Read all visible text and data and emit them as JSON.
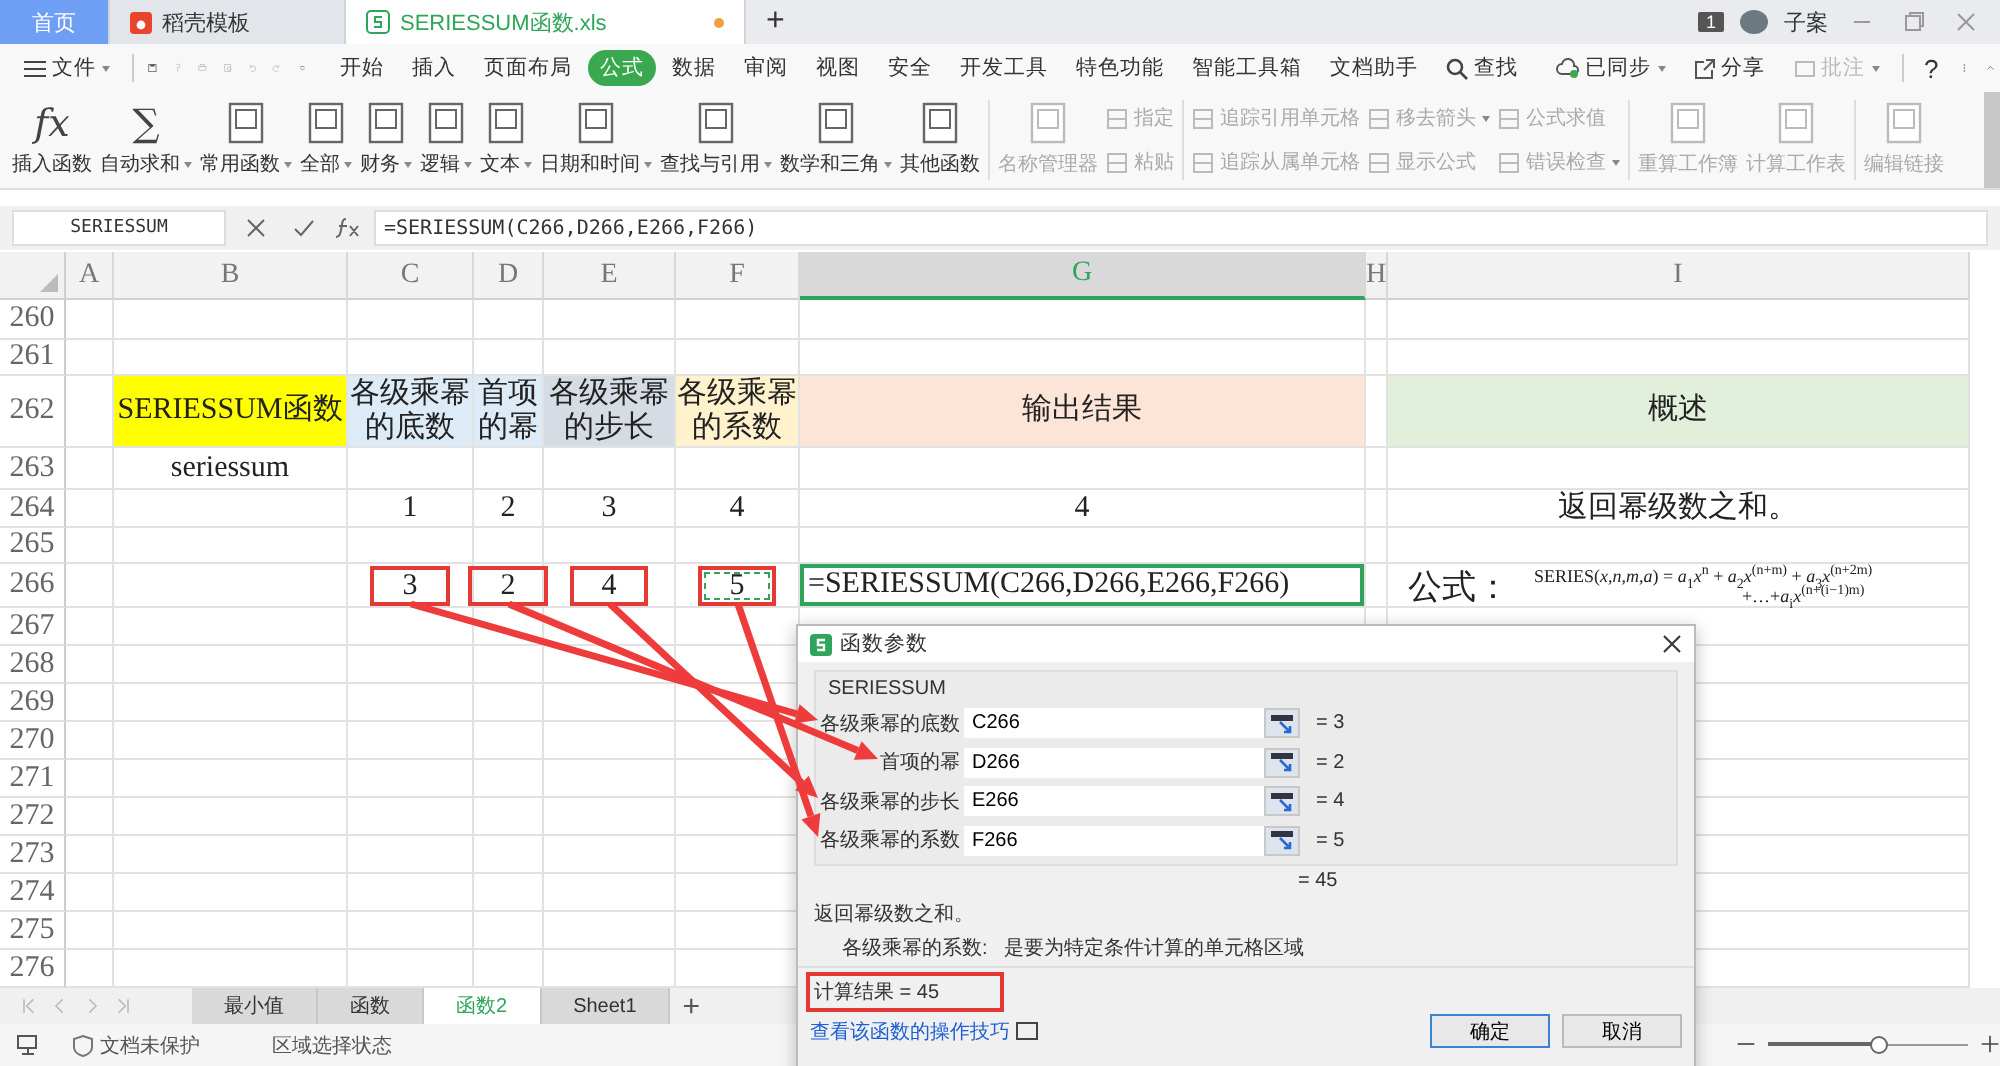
{
  "title_bar": {
    "tabs": [
      {
        "label": "首页",
        "kind": "home",
        "selected": false
      },
      {
        "label": "稻壳模板",
        "kind": "docer",
        "selected": false
      },
      {
        "label": "SERIESSUM函数.xls",
        "kind": "sheet",
        "selected": true,
        "unsaved": true
      }
    ],
    "new_tab": "+",
    "badge": "1",
    "user": "子案"
  },
  "menu": {
    "file": "文件",
    "tabs": [
      {
        "label": "开始",
        "selected": false
      },
      {
        "label": "插入",
        "selected": false
      },
      {
        "label": "页面布局",
        "selected": false
      },
      {
        "label": "公式",
        "selected": true
      },
      {
        "label": "数据",
        "selected": false
      },
      {
        "label": "审阅",
        "selected": false
      },
      {
        "label": "视图",
        "selected": false
      },
      {
        "label": "安全",
        "selected": false
      },
      {
        "label": "开发工具",
        "selected": false
      },
      {
        "label": "特色功能",
        "selected": false
      },
      {
        "label": "智能工具箱",
        "selected": false
      },
      {
        "label": "文档助手",
        "selected": false
      }
    ],
    "search": "查找",
    "sync": "已同步",
    "share": "分享",
    "comment": "批注",
    "help": "?"
  },
  "ribbon": {
    "items": [
      {
        "kind": "large",
        "label": "插入函数",
        "glyph": "fx",
        "has_menu": false,
        "disabled": false
      },
      {
        "kind": "large",
        "label": "自动求和",
        "glyph": "∑",
        "has_menu": true,
        "disabled": false
      },
      {
        "kind": "large",
        "label": "常用函数",
        "has_menu": true,
        "disabled": false
      },
      {
        "kind": "large",
        "label": "全部",
        "has_menu": true,
        "disabled": false
      },
      {
        "kind": "large",
        "label": "财务",
        "has_menu": true,
        "disabled": false
      },
      {
        "kind": "large",
        "label": "逻辑",
        "has_menu": true,
        "disabled": false
      },
      {
        "kind": "large",
        "label": "文本",
        "has_menu": true,
        "disabled": false
      },
      {
        "kind": "large",
        "label": "日期和时间",
        "has_menu": true,
        "disabled": false
      },
      {
        "kind": "large",
        "label": "查找与引用",
        "has_menu": true,
        "disabled": false
      },
      {
        "kind": "large",
        "label": "数学和三角",
        "has_menu": true,
        "disabled": false
      },
      {
        "kind": "large",
        "label": "其他函数",
        "has_menu": false,
        "disabled": false
      },
      {
        "kind": "divider"
      },
      {
        "kind": "large",
        "label": "名称管理器",
        "has_menu": false,
        "disabled": true
      },
      {
        "kind": "pair",
        "top": "指定",
        "bottom": "粘贴",
        "disabled": true
      },
      {
        "kind": "divider"
      },
      {
        "kind": "pair",
        "top": "追踪引用单元格",
        "bottom": "追踪从属单元格",
        "disabled": true
      },
      {
        "kind": "pair",
        "top": "移去箭头",
        "bottom": "显示公式",
        "top_menu": true,
        "bottom_menu": false,
        "disabled": true
      },
      {
        "kind": "pair",
        "top": "公式求值",
        "bottom": "错误检查",
        "top_menu": false,
        "bottom_menu": true,
        "disabled": true
      },
      {
        "kind": "divider"
      },
      {
        "kind": "large",
        "label": "重算工作簿",
        "has_menu": false,
        "disabled": true
      },
      {
        "kind": "large",
        "label": "计算工作表",
        "has_menu": false,
        "disabled": true
      },
      {
        "kind": "divider"
      },
      {
        "kind": "large",
        "label": "编辑链接",
        "has_menu": false,
        "disabled": true
      }
    ]
  },
  "formula_bar": {
    "name_box": "SERIESSUM",
    "formula": "=SERIESSUM(C266,D266,E266,F266)"
  },
  "sheet": {
    "columns": [
      {
        "label": "A",
        "selected": false
      },
      {
        "label": "B",
        "selected": false
      },
      {
        "label": "C",
        "selected": false
      },
      {
        "label": "D",
        "selected": false
      },
      {
        "label": "E",
        "selected": false
      },
      {
        "label": "F",
        "selected": false
      },
      {
        "label": "G",
        "selected": true
      },
      {
        "label": "H",
        "selected": false
      },
      {
        "label": "I",
        "selected": false
      }
    ],
    "rows": [
      {
        "number": "260"
      },
      {
        "number": "261"
      },
      {
        "number": "262",
        "cells": [
          {},
          {
            "text": "SERIESSUM函数",
            "color": "#ffff00",
            "selected": false
          },
          {
            "text": "各级乘幂的底数",
            "color": "#ddebf7",
            "selected": false
          },
          {
            "text": "首项的幂",
            "color": "#ddebf7",
            "selected": false
          },
          {
            "text": "各级乘幂的步长",
            "color": "#d6dce4",
            "selected": false
          },
          {
            "text": "各级乘幂的系数",
            "color": "#fff2cc",
            "selected": false
          },
          {
            "text": "输出结果",
            "color": "#fce4d6",
            "selected": false
          },
          {},
          {
            "text": "概述",
            "color": "#e2efda",
            "selected": false
          }
        ]
      },
      {
        "number": "263",
        "cells": [
          {},
          {
            "text": "seriessum",
            "selected": false
          }
        ]
      },
      {
        "number": "264",
        "cells": [
          {},
          {},
          {
            "text": "1",
            "selected": false
          },
          {
            "text": "2",
            "selected": false
          },
          {
            "text": "3",
            "selected": false
          },
          {
            "text": "4",
            "selected": false
          },
          {
            "text": "4",
            "selected": false
          },
          {},
          {
            "text": "返回幂级数之和。",
            "selected": false
          }
        ]
      },
      {
        "number": "265"
      },
      {
        "number": "266",
        "cells": [
          {},
          {},
          {
            "text": "3",
            "selected": false,
            "boxed": true
          },
          {
            "text": "2",
            "selected": false,
            "boxed": true
          },
          {
            "text": "4",
            "selected": false,
            "boxed": true
          },
          {
            "text": "5",
            "selected": false,
            "boxed": true,
            "marquee": true
          },
          {
            "text": "=SERIESSUM(C266,D266,E266,F266)",
            "selected": true
          },
          {},
          {
            "kind": "formula",
            "label": "公式：",
            "lines": [
              "SERIES(*x*,*n*,*m*,*a*) = *a*$_{1}$*x*$^{n}$ + *a*$_{2}$*x*$^{(n+m)}$ + *a*$_{3}$*x*$^{(n+2m)}$",
              "+…+*a*$_{i}$*x*$^{(n+(i−1)m)}$"
            ]
          }
        ]
      },
      {
        "number": "267"
      },
      {
        "number": "268"
      },
      {
        "number": "269"
      },
      {
        "number": "270"
      },
      {
        "number": "271"
      },
      {
        "number": "272"
      },
      {
        "number": "273"
      },
      {
        "number": "274"
      },
      {
        "number": "275"
      },
      {
        "number": "276"
      }
    ],
    "tabs": [
      {
        "label": "最小值",
        "selected": false
      },
      {
        "label": "函数",
        "selected": false
      },
      {
        "label": "函数2",
        "selected": true
      },
      {
        "label": "Sheet1",
        "selected": false
      }
    ],
    "add_tab": "+"
  },
  "dialog": {
    "title": "函数参数",
    "function": "SERIESSUM",
    "args": [
      {
        "label": "各级乘幂的底数",
        "value": "C266",
        "result": "= 3",
        "pointed": true
      },
      {
        "label": "首项的幂",
        "value": "D266",
        "result": "= 2",
        "pointed": true
      },
      {
        "label": "各级乘幂的步长",
        "value": "E266",
        "result": "= 4",
        "pointed": true
      },
      {
        "label": "各级乘幂的系数",
        "value": "F266",
        "result": "= 5",
        "pointed": true
      }
    ],
    "total": "= 45",
    "description": "返回幂级数之和。",
    "help_label": "各级乘幂的系数:",
    "help": "是要为特定条件计算的单元格区域",
    "result": "计算结果 = 45",
    "result_boxed": true,
    "link": "查看该函数的操作技巧",
    "buttons": [
      {
        "label": "确定",
        "primary": true
      },
      {
        "label": "取消",
        "primary": false
      }
    ]
  },
  "status_bar": {
    "protection": "文档未保护",
    "mode": "区域选择状态",
    "zoom": {
      "level": 0.55
    }
  }
}
